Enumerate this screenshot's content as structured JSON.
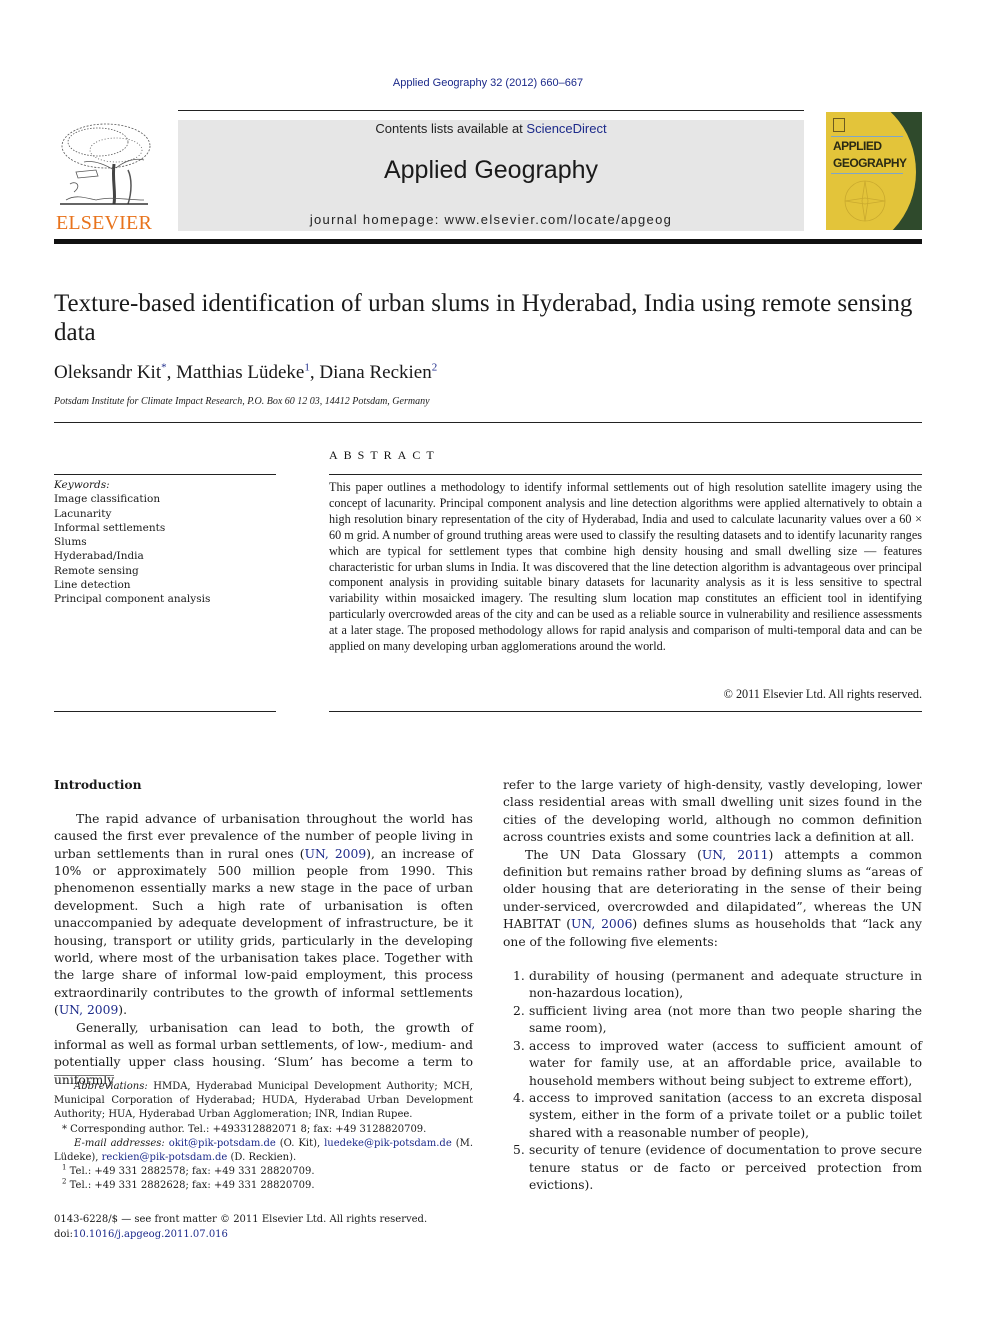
{
  "running_head": "Applied Geography 32 (2012) 660–667",
  "header": {
    "publisher_logo_text": "ELSEVIER",
    "contents_prefix": "Contents lists available at ",
    "contents_link": "ScienceDirect",
    "journal_title": "Applied Geography",
    "homepage": "journal homepage: www.elsevier.com/locate/apgeog",
    "cover_title_line1": "APPLIED",
    "cover_title_line2": "GEOGRAPHY"
  },
  "colors": {
    "link": "#1c2a8a",
    "elsevier_orange": "#e8731c",
    "banner_gray": "#e6e6e6",
    "cover_yellow": "#e3c43a",
    "cover_green": "#2f4a2c"
  },
  "article": {
    "title": "Texture-based identification of urban slums in Hyderabad, India using remote sensing data",
    "authors": [
      {
        "name": "Oleksandr Kit",
        "mark": "*"
      },
      {
        "name": "Matthias Lüdeke",
        "mark": "1"
      },
      {
        "name": "Diana Reckien",
        "mark": "2"
      }
    ],
    "author_sep": ", ",
    "affiliation": "Potsdam Institute for Climate Impact Research, P.O. Box 60 12 03, 14412 Potsdam, Germany"
  },
  "keywords": {
    "label": "Keywords:",
    "items": [
      "Image classification",
      "Lacunarity",
      "Informal settlements",
      "Slums",
      "Hyderabad/India",
      "Remote sensing",
      "Line detection",
      "Principal component analysis"
    ]
  },
  "abstract": {
    "heading": "ABSTRACT",
    "text": "This paper outlines a methodology to identify informal settlements out of high resolution satellite imagery using the concept of lacunarity. Principal component analysis and line detection algorithms were applied alternatively to obtain a high resolution binary representation of the city of Hyderabad, India and used to calculate lacunarity values over a 60 × 60 m grid. A number of ground truthing areas were used to classify the resulting datasets and to identify lacunarity ranges which are typical for settlement types that combine high density housing and small dwelling size — features characteristic for urban slums in India. It was discovered that the line detection algorithm is advantageous over principal component analysis in providing suitable binary datasets for lacunarity analysis as it is less sensitive to spectral variability within mosaicked imagery. The resulting slum location map constitutes an efficient tool in identifying particularly overcrowded areas of the city and can be used as a reliable source in vulnerability and resilience assessments at a later stage. The proposed methodology allows for rapid analysis and comparison of multi-temporal data and can be applied on many developing urban agglomerations around the world.",
    "copyright": "© 2011 Elsevier Ltd. All rights reserved."
  },
  "body": {
    "section_heading": "Introduction",
    "p1": {
      "before": "The rapid advance of urbanisation throughout the world has caused the first ever prevalence of the number of people living in urban settlements than in rural ones (",
      "cite1": "UN, 2009",
      "middle": "), an increase of 10% or approximately 500 million people from 1990. This phenomenon essentially marks a new stage in the pace of urban development. Such a high rate of urbanisation is often unaccompanied by adequate development of infrastructure, be it housing, transport or utility grids, particularly in the developing world, where most of the urbanisation takes place. Together with the large share of informal low-paid employment, this process extraordinarily contributes to the growth of informal settlements (",
      "cite2": "UN, 2009",
      "after": ")."
    },
    "p2": "Generally, urbanisation can lead to both, the growth of informal as well as formal urban settlements, of low-, medium- and potentially upper class housing. ‘Slum’ has become a term to uniformly",
    "p2_cont": "refer to the large variety of high-density, vastly developing, lower class residential areas with small dwelling unit sizes found in the cities of the developing world, although no common definition across countries exists and some countries lack a definition at all.",
    "p3": {
      "before": "The UN Data Glossary (",
      "cite1": "UN, 2011",
      "middle": ") attempts a common definition but remains rather broad by defining slums as “areas of older housing that are deteriorating in the sense of their being under-serviced, overcrowded and dilapidated”, whereas the UN HABITAT (",
      "cite2": "UN, 2006",
      "after": ") defines slums as households that “lack any one of the following five elements:"
    },
    "list": [
      {
        "num": "1.",
        "text": "durability of housing (permanent and adequate structure in non-hazardous location),"
      },
      {
        "num": "2.",
        "text": "sufficient living area (not more than two people sharing the same room),"
      },
      {
        "num": "3.",
        "text": "access to improved water (access to sufficient amount of water for family use, at an affordable price, available to household members without being subject to extreme effort),"
      },
      {
        "num": "4.",
        "text": "access to improved sanitation (access to an excreta disposal system, either in the form of a private toilet or a public toilet shared with a reasonable number of people),"
      },
      {
        "num": "5.",
        "text": "security of tenure (evidence of documentation to prove secure tenure status or de facto or perceived protection from evictions)."
      }
    ]
  },
  "footnotes": {
    "abbrev_label": "Abbreviations:",
    "abbrev_text": " HMDA, Hyderabad Municipal Development Authority; MCH, Municipal Corporation of Hyderabad; HUDA, Hyderabad Urban Development Authority; HUA, Hyderabad Urban Agglomeration; INR, Indian Rupee.",
    "corresponding_mark": "*",
    "corresponding": " Corresponding author. Tel.: +493312882071 8; fax: +49 3128820709.",
    "email_label": "E-mail addresses:",
    "email1": "okit@pik-potsdam.de",
    "email1_name": " (O. Kit), ",
    "email2": "luedeke@pik-potsdam.de",
    "email2_name": " (M. Lüdeke), ",
    "email3": "reckien@pik-potsdam.de",
    "email3_name": " (D. Reckien).",
    "fn1_mark": "1",
    "fn1": " Tel.: +49 331 2882578; fax: +49 331 28820709.",
    "fn2_mark": "2",
    "fn2": " Tel.: +49 331 2882628; fax: +49 331 28820709."
  },
  "bottom": {
    "issn_line": "0143-6228/$ — see front matter © 2011 Elsevier Ltd. All rights reserved.",
    "doi_prefix": "doi:",
    "doi": "10.1016/j.apgeog.2011.07.016"
  }
}
